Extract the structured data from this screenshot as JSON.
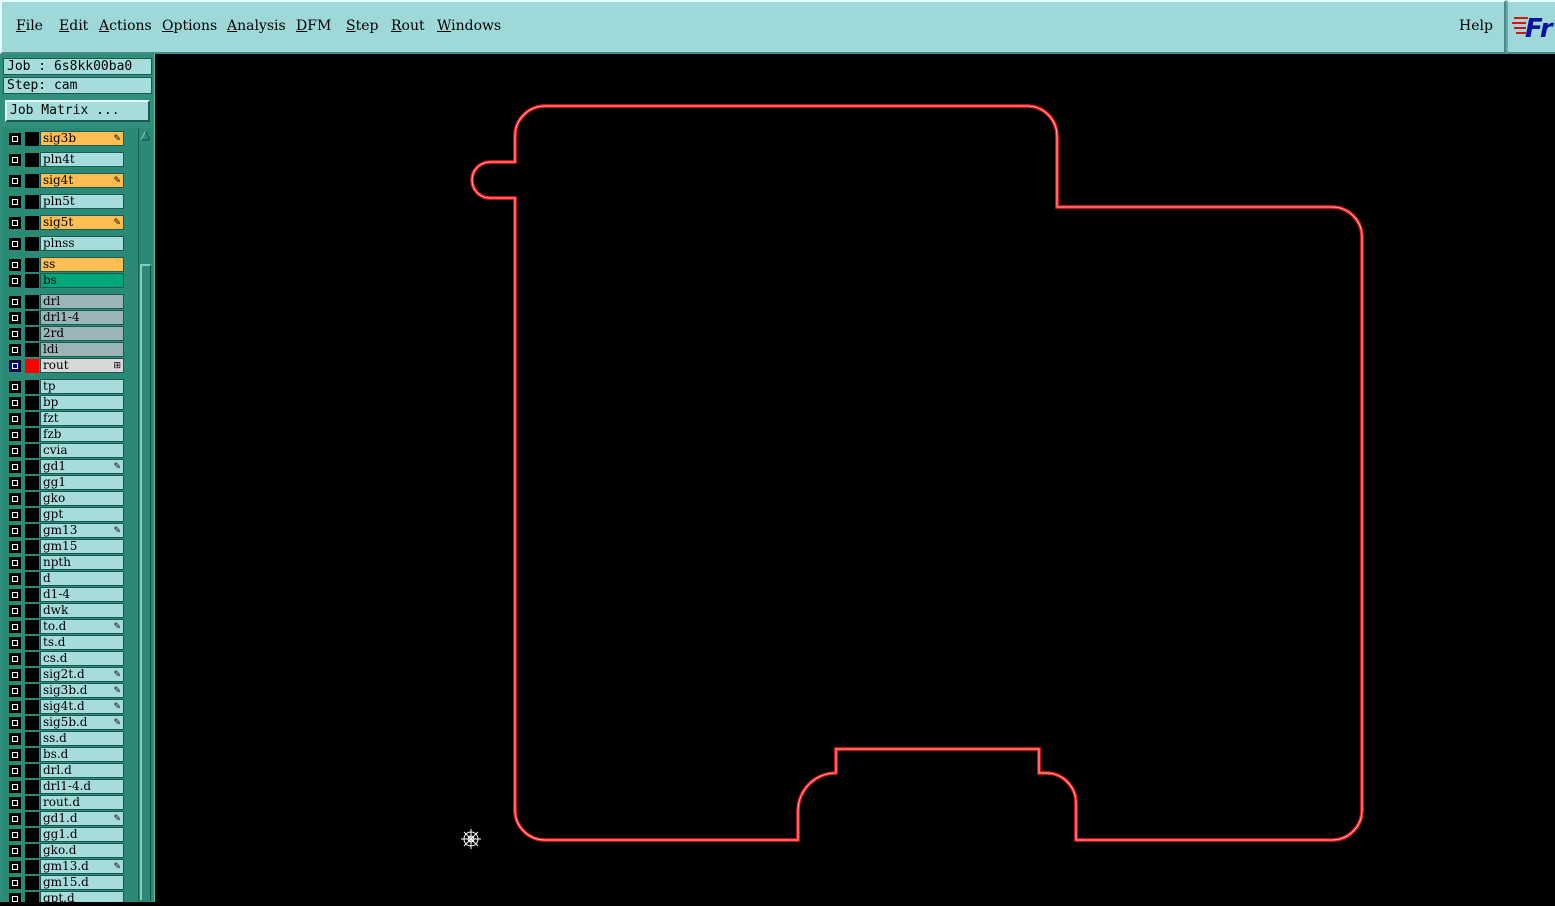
{
  "menubar": {
    "items": [
      {
        "label": "File",
        "ul": "F"
      },
      {
        "label": "Edit",
        "ul": "E"
      },
      {
        "label": "Actions",
        "ul": "A"
      },
      {
        "label": "Options",
        "ul": "O"
      },
      {
        "label": "Analysis",
        "ul": "A"
      },
      {
        "label": "DFM",
        "ul": "D"
      },
      {
        "label": "Step",
        "ul": "S"
      },
      {
        "label": "Rout",
        "ul": "R"
      },
      {
        "label": "Windows",
        "ul": "W"
      }
    ],
    "help": "Help"
  },
  "logo": {
    "text": "Fr"
  },
  "panel": {
    "job_text": "Job : 6s8kk00ba0",
    "step_text": "Step: cam",
    "job_matrix_label": "Job Matrix ..."
  },
  "layers": [
    {
      "name": "sig3b",
      "color": "#ffbd52",
      "marked": true
    },
    {
      "name": "pln4t",
      "color": "#a6dcdc",
      "marked": false
    },
    {
      "name": "sig4t",
      "color": "#ffbd52",
      "marked": true
    },
    {
      "name": "pln5t",
      "color": "#a6dcdc",
      "marked": false
    },
    {
      "name": "sig5t",
      "color": "#ffbd52",
      "marked": true
    },
    {
      "name": "plnss",
      "color": "#a6dcdc",
      "marked": false
    },
    {
      "name": "ss",
      "color": "#ffbd52",
      "marked": false
    },
    {
      "name": "bs",
      "color": "#00a77c",
      "marked": false
    },
    {
      "name": "drl",
      "color": "#9ab4b8",
      "marked": false
    },
    {
      "name": "drl1-4",
      "color": "#9ab4b8",
      "marked": false
    },
    {
      "name": "2rd",
      "color": "#9ab4b8",
      "marked": false
    },
    {
      "name": "ldi",
      "color": "#9ab4b8",
      "marked": false
    },
    {
      "name": "rout",
      "color": "#d8d8d8",
      "marked": false,
      "active": true
    },
    {
      "name": "tp",
      "color": "#a6dcdc",
      "marked": false
    },
    {
      "name": "bp",
      "color": "#a6dcdc",
      "marked": false
    },
    {
      "name": "fzt",
      "color": "#a6dcdc",
      "marked": false
    },
    {
      "name": "fzb",
      "color": "#a6dcdc",
      "marked": false
    },
    {
      "name": "cvia",
      "color": "#a6dcdc",
      "marked": false
    },
    {
      "name": "gd1",
      "color": "#a6dcdc",
      "marked": true
    },
    {
      "name": "gg1",
      "color": "#a6dcdc",
      "marked": false
    },
    {
      "name": "gko",
      "color": "#a6dcdc",
      "marked": false
    },
    {
      "name": "gpt",
      "color": "#a6dcdc",
      "marked": false
    },
    {
      "name": "gm13",
      "color": "#a6dcdc",
      "marked": true
    },
    {
      "name": "gm15",
      "color": "#a6dcdc",
      "marked": false
    },
    {
      "name": "npth",
      "color": "#a6dcdc",
      "marked": false
    },
    {
      "name": "d",
      "color": "#a6dcdc",
      "marked": false
    },
    {
      "name": "d1-4",
      "color": "#a6dcdc",
      "marked": false
    },
    {
      "name": "dwk",
      "color": "#a6dcdc",
      "marked": false
    },
    {
      "name": "to.d",
      "color": "#a6dcdc",
      "marked": true
    },
    {
      "name": "ts.d",
      "color": "#a6dcdc",
      "marked": false
    },
    {
      "name": "cs.d",
      "color": "#a6dcdc",
      "marked": false
    },
    {
      "name": "sig2t.d",
      "color": "#a6dcdc",
      "marked": true
    },
    {
      "name": "sig3b.d",
      "color": "#a6dcdc",
      "marked": true
    },
    {
      "name": "sig4t.d",
      "color": "#a6dcdc",
      "marked": true
    },
    {
      "name": "sig5b.d",
      "color": "#a6dcdc",
      "marked": true
    },
    {
      "name": "ss.d",
      "color": "#a6dcdc",
      "marked": false
    },
    {
      "name": "bs.d",
      "color": "#a6dcdc",
      "marked": false
    },
    {
      "name": "drl.d",
      "color": "#a6dcdc",
      "marked": false
    },
    {
      "name": "drl1-4.d",
      "color": "#a6dcdc",
      "marked": false
    },
    {
      "name": "rout.d",
      "color": "#a6dcdc",
      "marked": false
    },
    {
      "name": "gd1.d",
      "color": "#a6dcdc",
      "marked": true
    },
    {
      "name": "gg1.d",
      "color": "#a6dcdc",
      "marked": false
    },
    {
      "name": "gko.d",
      "color": "#a6dcdc",
      "marked": false
    },
    {
      "name": "gm13.d",
      "color": "#a6dcdc",
      "marked": true
    },
    {
      "name": "gm15.d",
      "color": "#a6dcdc",
      "marked": false
    },
    {
      "name": "gpt.d",
      "color": "#a6dcdc",
      "marked": false
    }
  ],
  "colors": {
    "outline": "#ff1a1a",
    "outline_core": "#ffe0e0",
    "canvas": "#000000",
    "active_box": "#000080",
    "active_swatch": "#ff0000"
  },
  "icons": {
    "cursor": "crosshair-target-icon",
    "layer_mark": "pencil-icon"
  }
}
